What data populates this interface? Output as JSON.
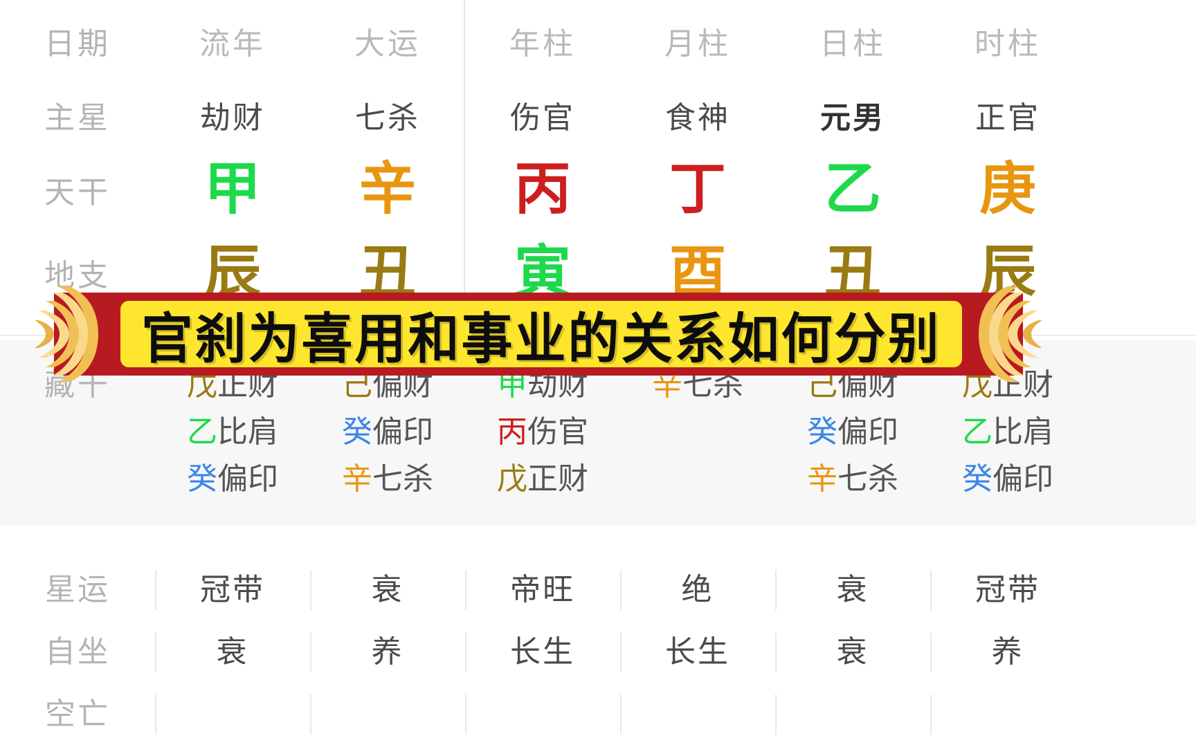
{
  "banner": {
    "text": "官刹为喜用和事业的关系如何分别",
    "bg_color": "#b81a21",
    "panel_color": "#ffe62e",
    "text_color": "#0d0d0d",
    "ornament_left": "scroll-end-left-icon",
    "ornament_right": "scroll-end-right-icon"
  },
  "colors": {
    "wood_green": "#1ed94b",
    "fire_red": "#cc1f1f",
    "earth_brown": "#9a7a12",
    "metal_orange": "#e8960f",
    "water_blue": "#3c86e8",
    "label_gray": "#b4b4b4",
    "value_gray": "#4a4a4a",
    "panel_gray": "#f7f7f7"
  },
  "row_labels": {
    "date": "日期",
    "main_star": "主星",
    "heavenly_stem": "天干",
    "earthly_branch": "地支",
    "hidden_stems": "藏干",
    "star_fortune": "星运",
    "self_sitting": "自坐",
    "void": "空亡"
  },
  "columns": [
    {
      "header": "流年",
      "main_star": "劫财",
      "main_star_bold": false,
      "stem": "甲",
      "stem_color": "#1ed94b",
      "branch": "辰",
      "branch_color": "#9a7a12",
      "hidden": [
        {
          "gan": "戊",
          "gan_color": "#9a7a12",
          "god": "正财"
        },
        {
          "gan": "乙",
          "gan_color": "#1ed94b",
          "god": "比肩"
        },
        {
          "gan": "癸",
          "gan_color": "#3c86e8",
          "god": "偏印"
        }
      ],
      "star_fortune": "冠带",
      "self_sitting": "衰"
    },
    {
      "header": "大运",
      "main_star": "七杀",
      "main_star_bold": false,
      "stem": "辛",
      "stem_color": "#e8960f",
      "branch": "丑",
      "branch_color": "#9a7a12",
      "hidden": [
        {
          "gan": "己",
          "gan_color": "#9a7a12",
          "god": "偏财"
        },
        {
          "gan": "癸",
          "gan_color": "#3c86e8",
          "god": "偏印"
        },
        {
          "gan": "辛",
          "gan_color": "#e8960f",
          "god": "七杀"
        }
      ],
      "star_fortune": "衰",
      "self_sitting": "养"
    },
    {
      "header": "年柱",
      "main_star": "伤官",
      "main_star_bold": false,
      "stem": "丙",
      "stem_color": "#cc1f1f",
      "branch": "寅",
      "branch_color": "#1ed94b",
      "hidden": [
        {
          "gan": "甲",
          "gan_color": "#1ed94b",
          "god": "劫财"
        },
        {
          "gan": "丙",
          "gan_color": "#cc1f1f",
          "god": "伤官"
        },
        {
          "gan": "戊",
          "gan_color": "#9a7a12",
          "god": "正财"
        }
      ],
      "star_fortune": "帝旺",
      "self_sitting": "长生"
    },
    {
      "header": "月柱",
      "main_star": "食神",
      "main_star_bold": false,
      "stem": "丁",
      "stem_color": "#cc1f1f",
      "branch": "酉",
      "branch_color": "#e8960f",
      "hidden": [
        {
          "gan": "辛",
          "gan_color": "#e8960f",
          "god": "七杀"
        },
        {
          "gan": "",
          "gan_color": "",
          "god": ""
        },
        {
          "gan": "",
          "gan_color": "",
          "god": ""
        }
      ],
      "star_fortune": "绝",
      "self_sitting": "长生"
    },
    {
      "header": "日柱",
      "main_star": "元男",
      "main_star_bold": true,
      "stem": "乙",
      "stem_color": "#1ed94b",
      "branch": "丑",
      "branch_color": "#9a7a12",
      "hidden": [
        {
          "gan": "己",
          "gan_color": "#9a7a12",
          "god": "偏财"
        },
        {
          "gan": "癸",
          "gan_color": "#3c86e8",
          "god": "偏印"
        },
        {
          "gan": "辛",
          "gan_color": "#e8960f",
          "god": "七杀"
        }
      ],
      "star_fortune": "衰",
      "self_sitting": "衰"
    },
    {
      "header": "时柱",
      "main_star": "正官",
      "main_star_bold": false,
      "stem": "庚",
      "stem_color": "#e8960f",
      "branch": "辰",
      "branch_color": "#9a7a12",
      "hidden": [
        {
          "gan": "戊",
          "gan_color": "#9a7a12",
          "god": "正财"
        },
        {
          "gan": "乙",
          "gan_color": "#1ed94b",
          "god": "比肩"
        },
        {
          "gan": "癸",
          "gan_color": "#3c86e8",
          "god": "偏印"
        }
      ],
      "star_fortune": "冠带",
      "self_sitting": "养"
    }
  ]
}
